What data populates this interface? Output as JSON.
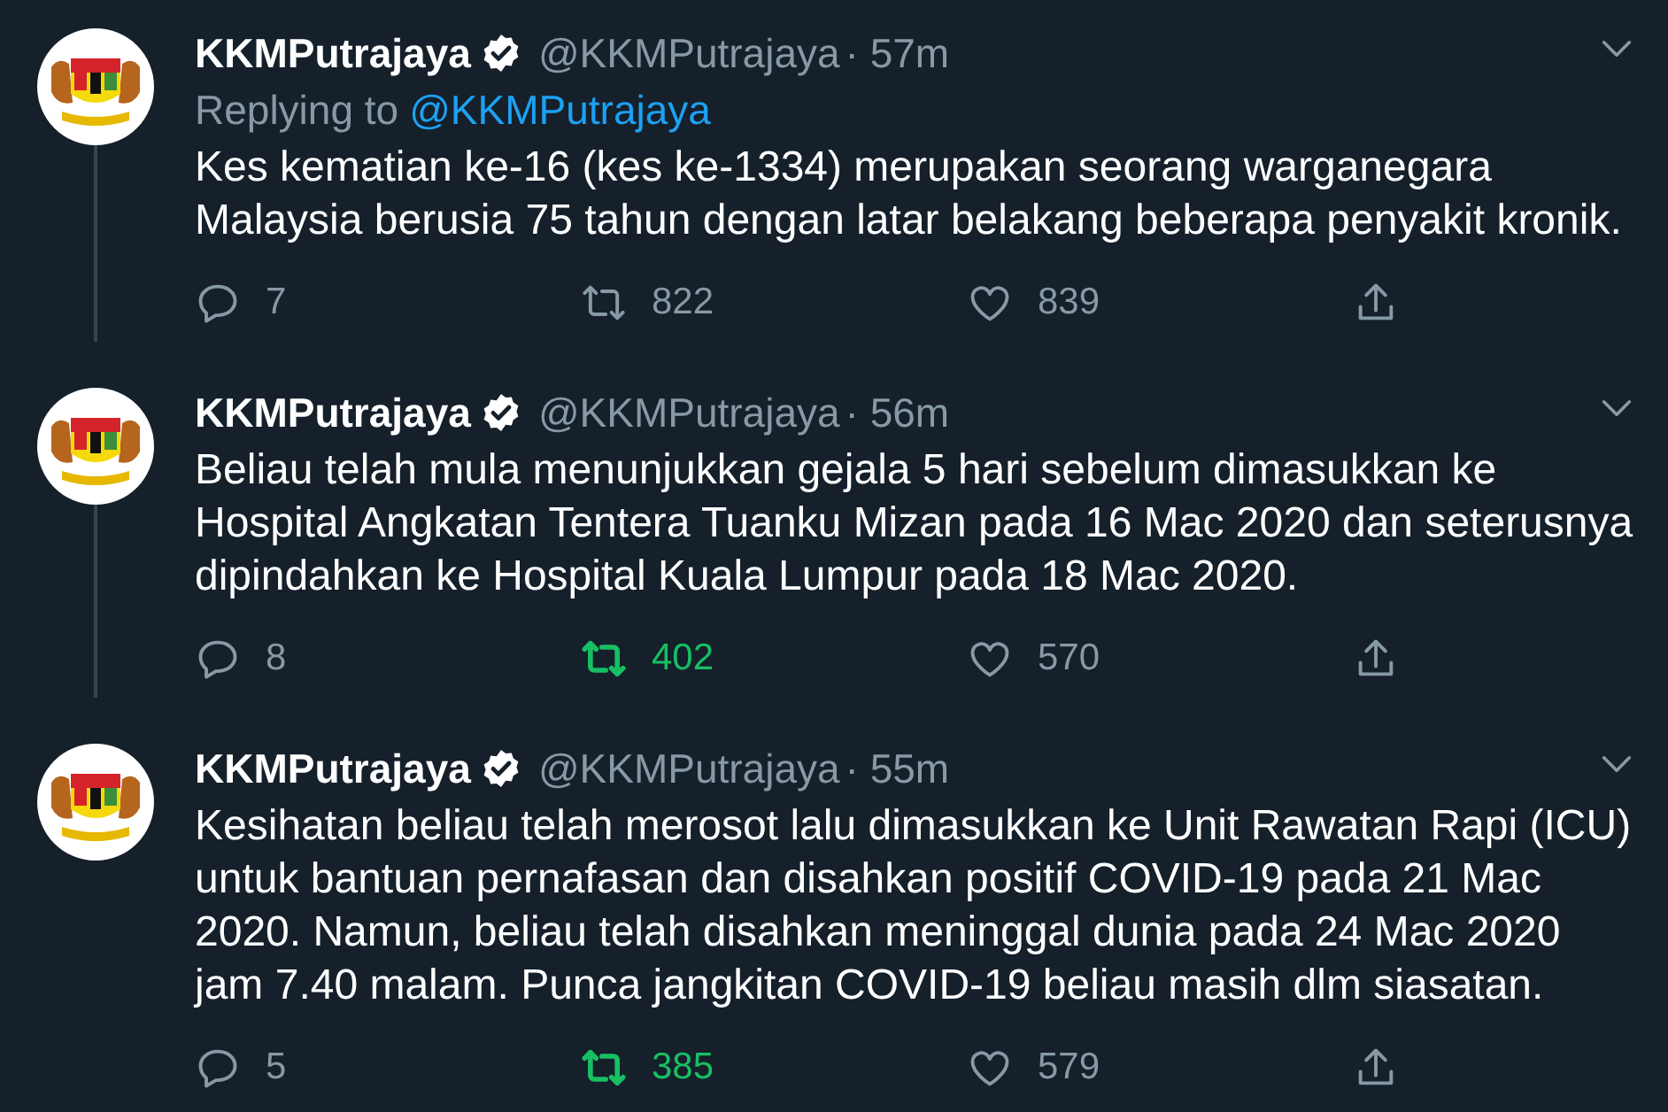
{
  "tweets": [
    {
      "name": "KKMPutrajaya",
      "verified": true,
      "handle": "@KKMPutrajaya",
      "time": "· 57m",
      "reply_prefix": "Replying to",
      "reply_to": "@KKMPutrajaya",
      "text": "Kes kematian ke-16 (kes ke-1334) merupakan seorang warganegara Malaysia berusia 75 tahun dengan latar belakang beberapa penyakit kronik.",
      "replies": "7",
      "retweets": "822",
      "retweeted": false,
      "likes": "839",
      "liked": false,
      "thread_continues": true
    },
    {
      "name": "KKMPutrajaya",
      "verified": true,
      "handle": "@KKMPutrajaya",
      "time": "· 56m",
      "text": "Beliau telah mula menunjukkan gejala 5 hari sebelum dimasukkan ke Hospital Angkatan Tentera Tuanku Mizan pada 16 Mac 2020 dan seterusnya dipindahkan ke Hospital Kuala Lumpur pada 18 Mac 2020.",
      "replies": "8",
      "retweets": "402",
      "retweeted": true,
      "likes": "570",
      "liked": false,
      "thread_continues": true
    },
    {
      "name": "KKMPutrajaya",
      "verified": true,
      "handle": "@KKMPutrajaya",
      "time": "· 55m",
      "text": "Kesihatan beliau telah merosot lalu dimasukkan ke Unit Rawatan Rapi (ICU) untuk bantuan pernafasan dan disahkan positif COVID-19 pada 21 Mac 2020. Namun, beliau telah disahkan meninggal dunia pada 24 Mac 2020 jam 7.40 malam. Punca jangkitan COVID-19 beliau masih dlm siasatan.",
      "replies": "5",
      "retweets": "385",
      "retweeted": true,
      "likes": "579",
      "liked": false,
      "thread_continues": false
    }
  ]
}
